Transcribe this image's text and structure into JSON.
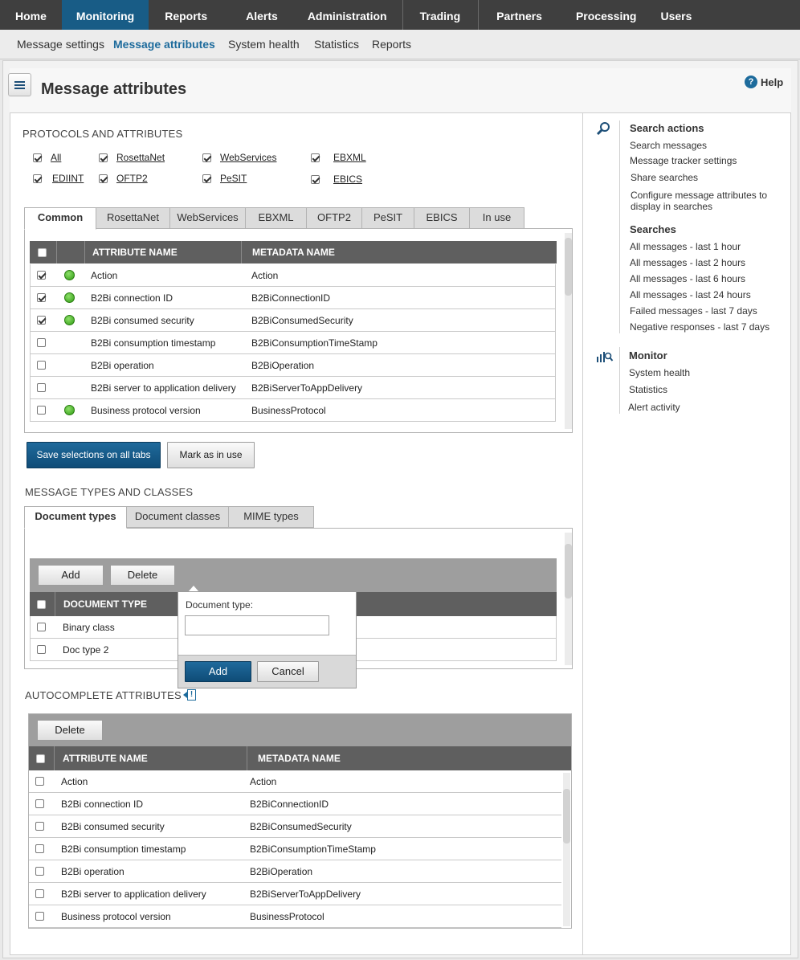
{
  "topnav": [
    "Home",
    "Monitoring",
    "Reports",
    "Alerts",
    "Administration",
    "Trading",
    "Partners",
    "Processing",
    "Users"
  ],
  "subnav": [
    "Message settings",
    "Message attributes",
    "System health",
    "Statistics",
    "Reports"
  ],
  "page_title": "Message attributes",
  "help_label": "Help",
  "help_icon": "?",
  "protocols": {
    "title": "PROTOCOLS AND ATTRIBUTES",
    "items": [
      {
        "label": "All",
        "checked": true
      },
      {
        "label": "RosettaNet",
        "checked": true
      },
      {
        "label": "WebServices",
        "checked": true
      },
      {
        "label": "EBXML",
        "checked": true
      },
      {
        "label": "EDIINT",
        "checked": true
      },
      {
        "label": "OFTP2",
        "checked": true
      },
      {
        "label": "PeSIT",
        "checked": true
      },
      {
        "label": "EBICS",
        "checked": true
      }
    ]
  },
  "attr_tabs": [
    "Common",
    "RosettaNet",
    "WebServices",
    "EBXML",
    "OFTP2",
    "PeSIT",
    "EBICS",
    "In use"
  ],
  "attr_table": {
    "headers": {
      "name": "ATTRIBUTE NAME",
      "meta": "METADATA NAME"
    },
    "rows": [
      {
        "checked": true,
        "active": true,
        "name": "Action",
        "meta": "Action"
      },
      {
        "checked": true,
        "active": true,
        "name": "B2Bi connection ID",
        "meta": "B2BiConnectionID"
      },
      {
        "checked": true,
        "active": true,
        "name": "B2Bi consumed security",
        "meta": "B2BiConsumedSecurity"
      },
      {
        "checked": false,
        "active": false,
        "name": "B2Bi consumption timestamp",
        "meta": "B2BiConsumptionTimeStamp"
      },
      {
        "checked": false,
        "active": false,
        "name": "B2Bi operation",
        "meta": "B2BiOperation"
      },
      {
        "checked": false,
        "active": false,
        "name": "B2Bi server to application delivery",
        "meta": "B2BiServerToAppDelivery"
      },
      {
        "checked": false,
        "active": true,
        "name": "Business protocol version",
        "meta": "BusinessProtocol"
      }
    ]
  },
  "buttons": {
    "save": "Save selections on all tabs",
    "mark": "Mark as in use",
    "add": "Add",
    "delete": "Delete",
    "cancel": "Cancel"
  },
  "message_types": {
    "title": "MESSAGE TYPES AND CLASSES",
    "tabs": [
      "Document types",
      "Document classes",
      "MIME types"
    ],
    "header": "DOCUMENT TYPE",
    "rows": [
      "Binary class",
      "Doc type 2"
    ]
  },
  "popup": {
    "label": "Document type:",
    "value": ""
  },
  "autocomplete": {
    "title": "AUTOCOMPLETE ATTRIBUTES",
    "info_icon": "!",
    "headers": {
      "name": "ATTRIBUTE NAME",
      "meta": "METADATA NAME"
    },
    "rows": [
      {
        "name": "Action",
        "meta": "Action"
      },
      {
        "name": "B2Bi connection ID",
        "meta": "B2BiConnectionID"
      },
      {
        "name": "B2Bi consumed security",
        "meta": "B2BiConsumedSecurity"
      },
      {
        "name": "B2Bi consumption timestamp",
        "meta": "B2BiConsumptionTimeStamp"
      },
      {
        "name": "B2Bi operation",
        "meta": "B2BiOperation"
      },
      {
        "name": "B2Bi server to application delivery",
        "meta": "B2BiServerToAppDelivery"
      },
      {
        "name": "Business protocol version",
        "meta": "BusinessProtocol"
      }
    ]
  },
  "sidebar": {
    "search_actions": {
      "title": "Search actions",
      "icon": "magnifier-icon",
      "links": [
        "Search messages",
        "Message tracker settings",
        "Share searches",
        "Configure message attributes to display in searches"
      ]
    },
    "searches": {
      "title": "Searches",
      "links": [
        "All messages - last 1 hour",
        "All messages - last 2 hours",
        "All messages - last 6 hours",
        "All messages - last 24 hours",
        "Failed messages - last 7 days",
        "Negative responses - last 7 days"
      ]
    },
    "monitor": {
      "title": "Monitor",
      "icon": "monitor-chart-icon",
      "links": [
        "System health",
        "Statistics",
        "Alert activity"
      ]
    }
  },
  "colors": {
    "nav_bg": "#3f3f3f",
    "nav_active": "#185c86",
    "table_header": "#5f5f5f",
    "primary_button": "#0f4c77",
    "status_green": "#2f9b13"
  }
}
